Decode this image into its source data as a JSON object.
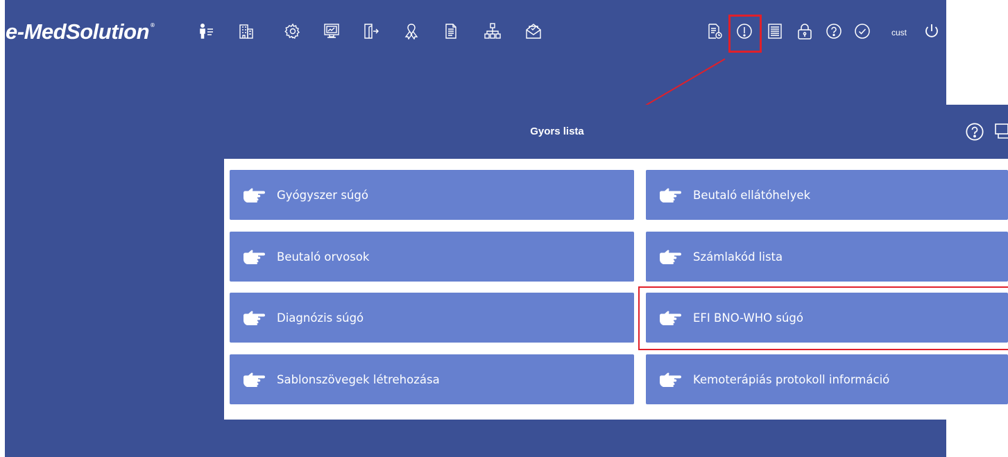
{
  "header": {
    "logo_text": "e-MedSolution",
    "logo_mark": "®",
    "user_label": "cust",
    "left_icons": [
      "person-list-icon",
      "building-icon",
      "settings-icon",
      "monitor-icon",
      "exit-door-icon",
      "ribbon-icon",
      "document-icon",
      "org-chart-icon",
      "envelope-icon"
    ],
    "right_icons": [
      "report-clock-icon",
      "info-icon",
      "list-icon",
      "lock-icon",
      "help-icon",
      "check-icon",
      "power-icon"
    ],
    "highlight_color": "#e0202a"
  },
  "panel": {
    "title": "Gyors lista",
    "buttons": [
      {
        "label": "Gyógyszer súgó"
      },
      {
        "label": "Beutaló ellátóhelyek"
      },
      {
        "label": "Beutaló orvosok"
      },
      {
        "label": "Számlakód lista"
      },
      {
        "label": "Diagnózis súgó"
      },
      {
        "label": "EFI BNO-WHO súgó"
      },
      {
        "label": "Sablonszövegek létrehozása"
      },
      {
        "label": "Kemoterápiás protokoll információ"
      }
    ],
    "button_color": "#6680cf",
    "background_color": "#3b5095"
  }
}
